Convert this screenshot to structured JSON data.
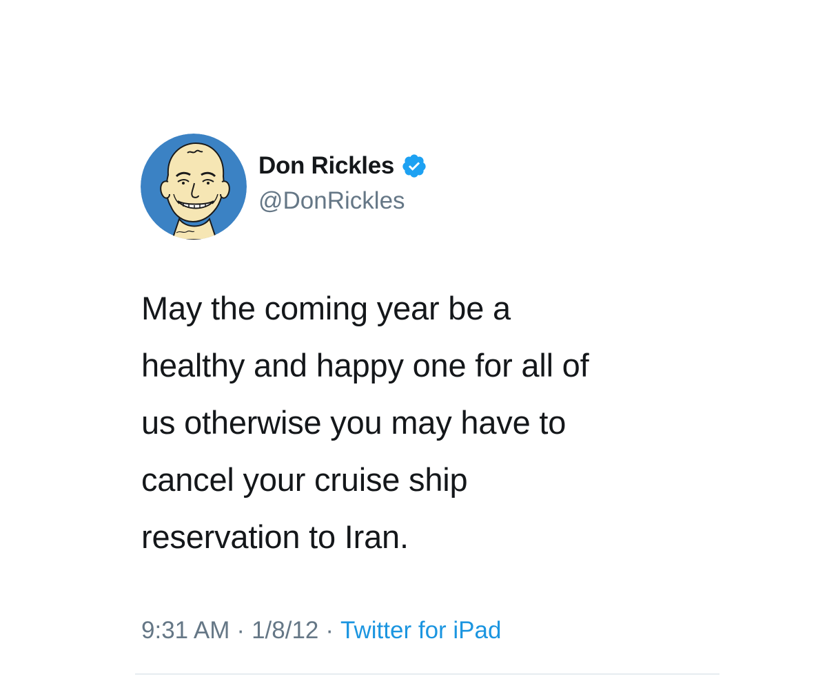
{
  "tweet": {
    "author": {
      "display_name": "Don Rickles",
      "handle": "@DonRickles",
      "verified": true,
      "avatar_icon": "caricature-avatar"
    },
    "text": "May the coming year be a\nhealthy and happy one for all of\nus otherwise you may have to\ncancel your cruise ship\nreservation to Iran.",
    "time": "9:31 AM",
    "date": "1/8/12",
    "separator": "·",
    "source": "Twitter for iPad"
  },
  "colors": {
    "text_primary": "#14171a",
    "text_secondary": "#657786",
    "link_blue": "#1b95e0",
    "avatar_bg": "#3b82c4",
    "divider": "#e6ecf0"
  }
}
